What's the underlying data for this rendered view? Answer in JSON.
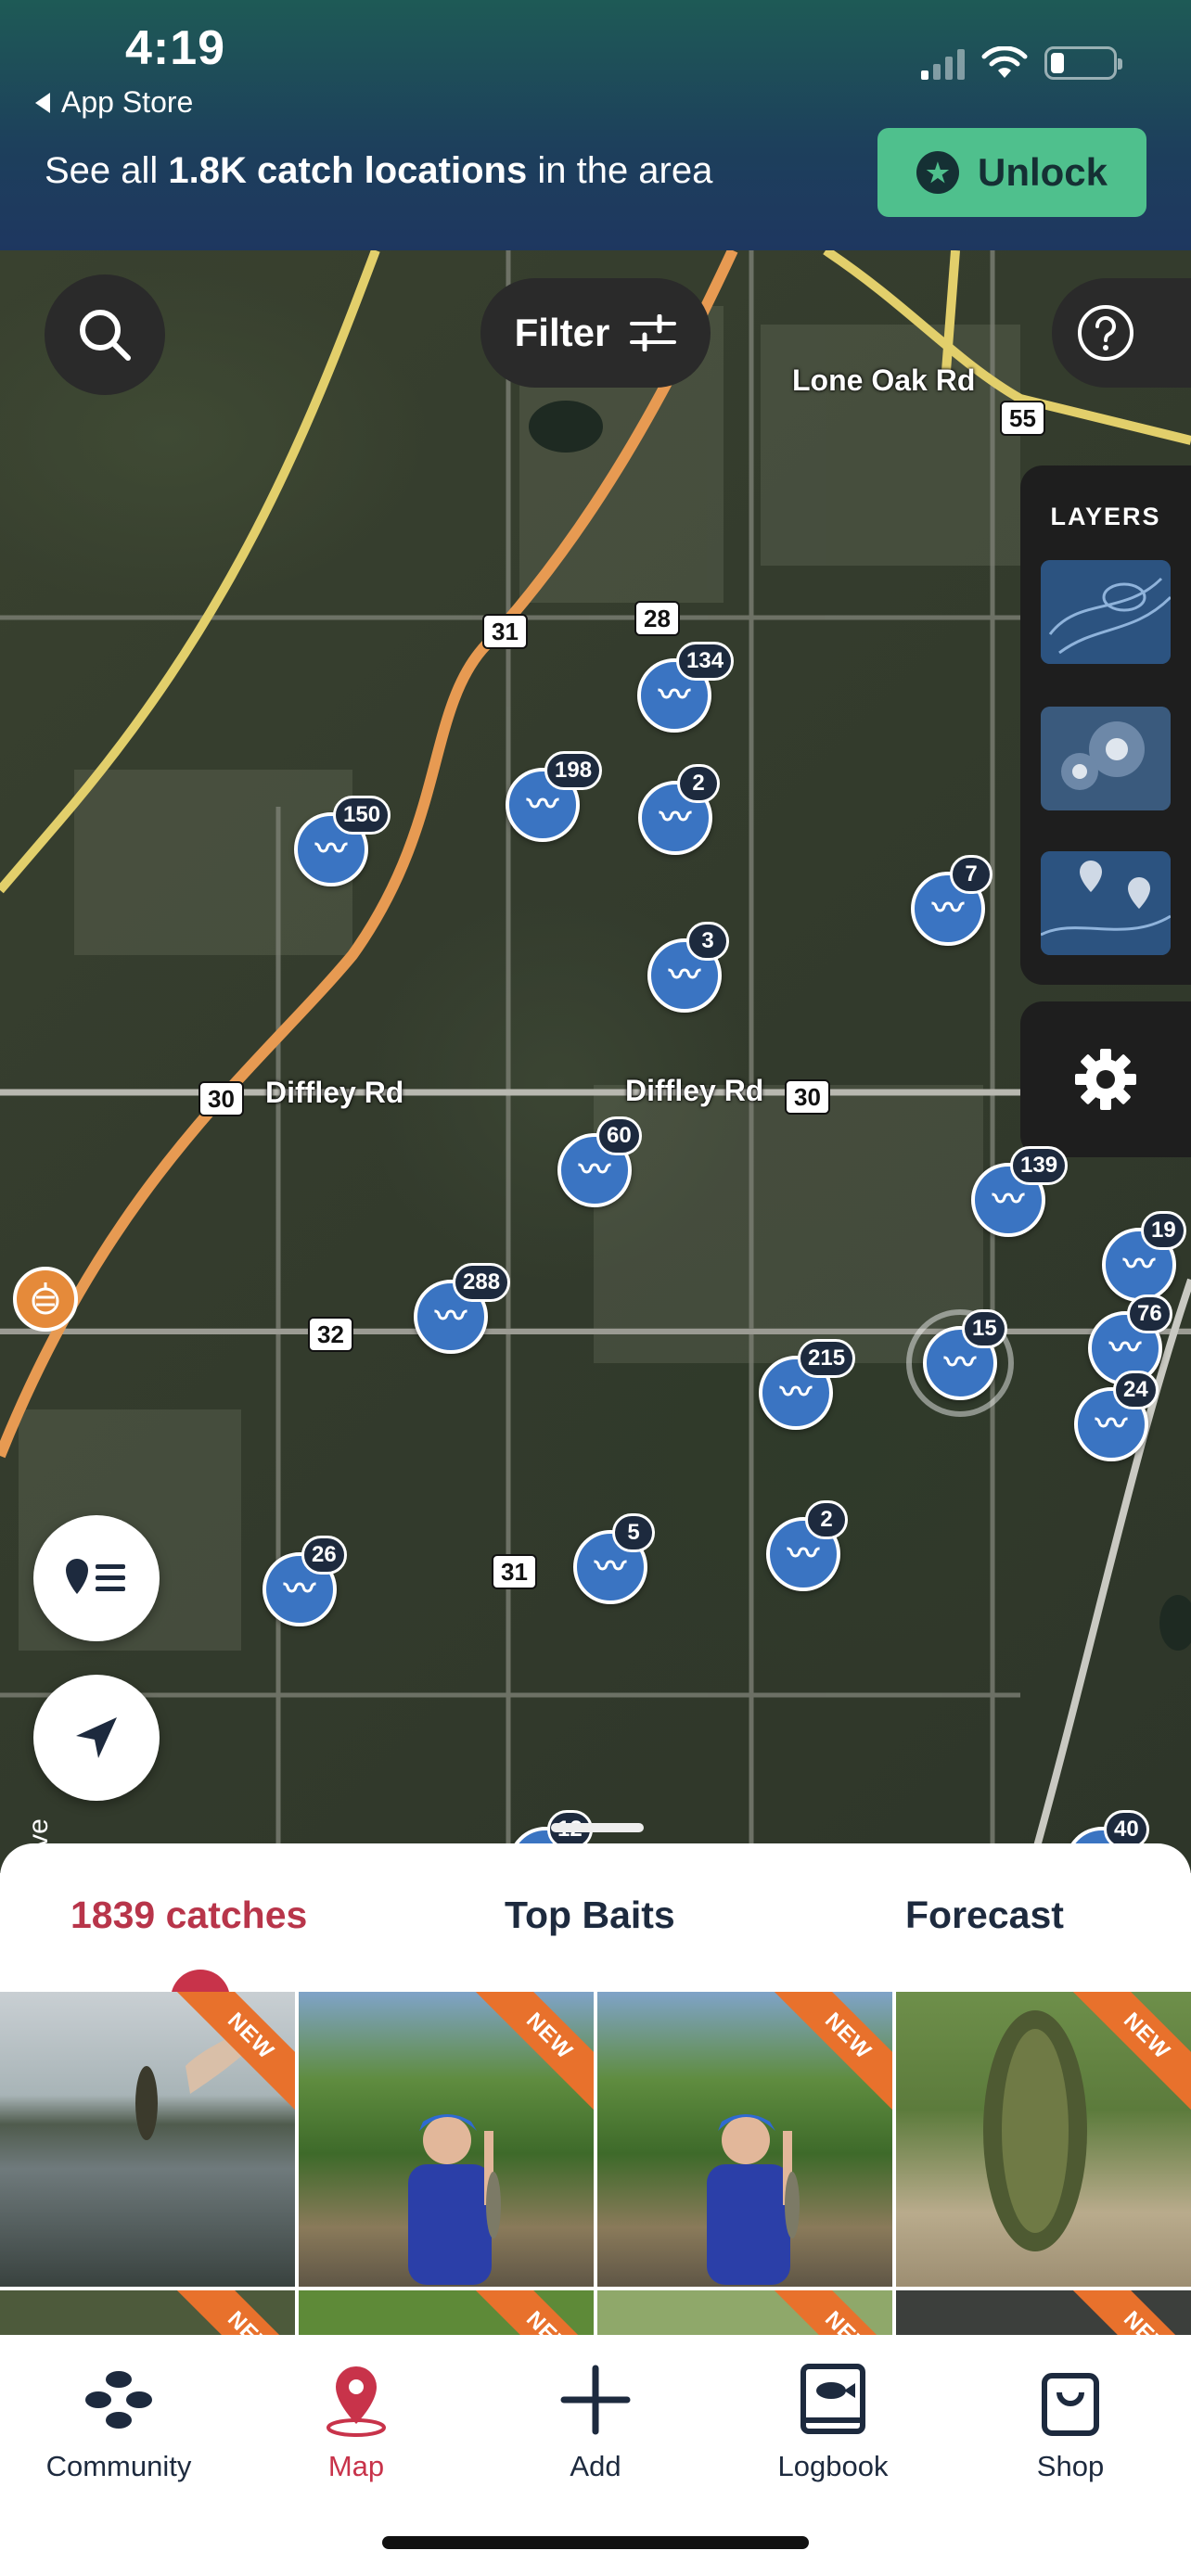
{
  "status_bar": {
    "time": "4:19",
    "back_app": "App Store"
  },
  "promo": {
    "text_prefix": "See all ",
    "text_bold": "1.8K catch locations",
    "text_suffix": " in the area",
    "unlock_label": "Unlock",
    "accent_color": "#4fc08d"
  },
  "map": {
    "filter_label": "Filter",
    "layers_title": "LAYERS",
    "road_labels": [
      "Lone Oak Rd",
      "Diffley Rd",
      "Diffley Rd"
    ],
    "route_shields": [
      "55",
      "31",
      "28",
      "30",
      "30",
      "32",
      "31"
    ],
    "catch_pins": [
      "134",
      "198",
      "2",
      "150",
      "7",
      "3",
      "60",
      "139",
      "19",
      "288",
      "215",
      "15",
      "76",
      "24",
      "26",
      "5",
      "2",
      "40",
      "12"
    ],
    "edge_text": "ve",
    "icons": {
      "search": "search-icon",
      "filter": "sliders-icon",
      "help": "question-icon",
      "settings": "gear-icon",
      "list": "pin-list-icon",
      "locate": "navigation-arrow-icon"
    }
  },
  "sheet": {
    "tabs": [
      "1839 catches",
      "Top Baits",
      "Forecast"
    ],
    "active_tab": 0,
    "new_label": "NEW",
    "accent_color": "#c8334a"
  },
  "tabbar": {
    "items": [
      {
        "label": "Community",
        "icon": "community-icon"
      },
      {
        "label": "Map",
        "icon": "map-pin-icon"
      },
      {
        "label": "Add",
        "icon": "plus-icon"
      },
      {
        "label": "Logbook",
        "icon": "logbook-icon"
      },
      {
        "label": "Shop",
        "icon": "shopping-bag-icon"
      }
    ],
    "active_index": 1
  }
}
